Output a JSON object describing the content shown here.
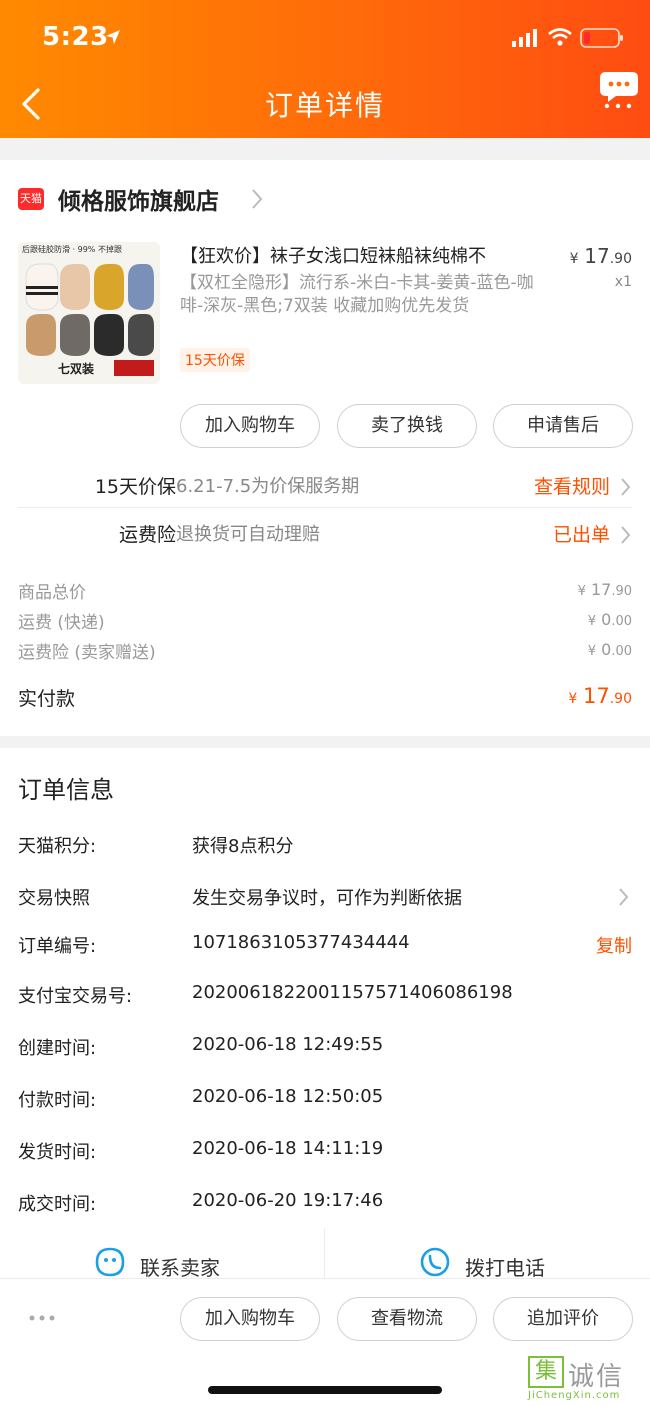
{
  "status_bar": {
    "time": "5:23"
  },
  "nav": {
    "title": "订单详情"
  },
  "store": {
    "badge": "天猫",
    "name": "倾格服饰旗舰店"
  },
  "product": {
    "image_banner": "后跟硅胶防滑 · 99% 不掉跟",
    "image_brand": "七双装",
    "title": "【狂欢价】袜子女浅口短袜船袜纯棉不",
    "price_symbol": "¥",
    "price_int": "17",
    "price_dec": ".90",
    "qty": "x1",
    "sku": "【双杠全隐形】流行系-米白-卡其-姜黄-蓝色-咖啡-深灰-黑色;7双装 收藏加购优先发货",
    "tag": "15天价保",
    "actions": [
      "加入购物车",
      "卖了换钱",
      "申请售后"
    ]
  },
  "services": [
    {
      "label": "15天价保",
      "desc": "6.21-7.5为价保服务期",
      "action": "查看规则"
    },
    {
      "label": "运费险",
      "desc": "退换货可自动理赔",
      "action": "已出单"
    }
  ],
  "fees": [
    {
      "label": "商品总价",
      "symbol": "¥",
      "int": "17",
      "dec": ".90"
    },
    {
      "label": "运费 (快递)",
      "symbol": "¥",
      "int": "0",
      "dec": ".00"
    },
    {
      "label": "运费险 (卖家赠送)",
      "symbol": "¥",
      "int": "0",
      "dec": ".00"
    }
  ],
  "total": {
    "label": "实付款",
    "symbol": "¥",
    "int": "17",
    "dec": ".90"
  },
  "order_info": {
    "title": "订单信息",
    "rows": [
      {
        "label": "天猫积分:",
        "value": "获得8点积分"
      },
      {
        "label": "交易快照",
        "value": "发生交易争议时，可作为判断依据"
      },
      {
        "label": "订单编号:",
        "value": "1071863105377434444",
        "action": "复制"
      },
      {
        "label": "支付宝交易号:",
        "value": "2020061822001157571406086198"
      },
      {
        "label": "创建时间:",
        "value": "2020-06-18 12:49:55"
      },
      {
        "label": "付款时间:",
        "value": "2020-06-18 12:50:05"
      },
      {
        "label": "发货时间:",
        "value": "2020-06-18 14:11:19"
      },
      {
        "label": "成交时间:",
        "value": "2020-06-20 19:17:46"
      }
    ]
  },
  "contact": {
    "seller": "联系卖家",
    "phone": "拨打电话"
  },
  "bottom_actions": [
    "加入购物车",
    "查看物流",
    "追加评价"
  ],
  "watermark": {
    "mark": "集",
    "cn": "诚信",
    "en": "JiChengXin.com"
  },
  "colors": {
    "accent": "#ff5000",
    "header_start": "#ff8a00",
    "header_end": "#ff4c12"
  }
}
